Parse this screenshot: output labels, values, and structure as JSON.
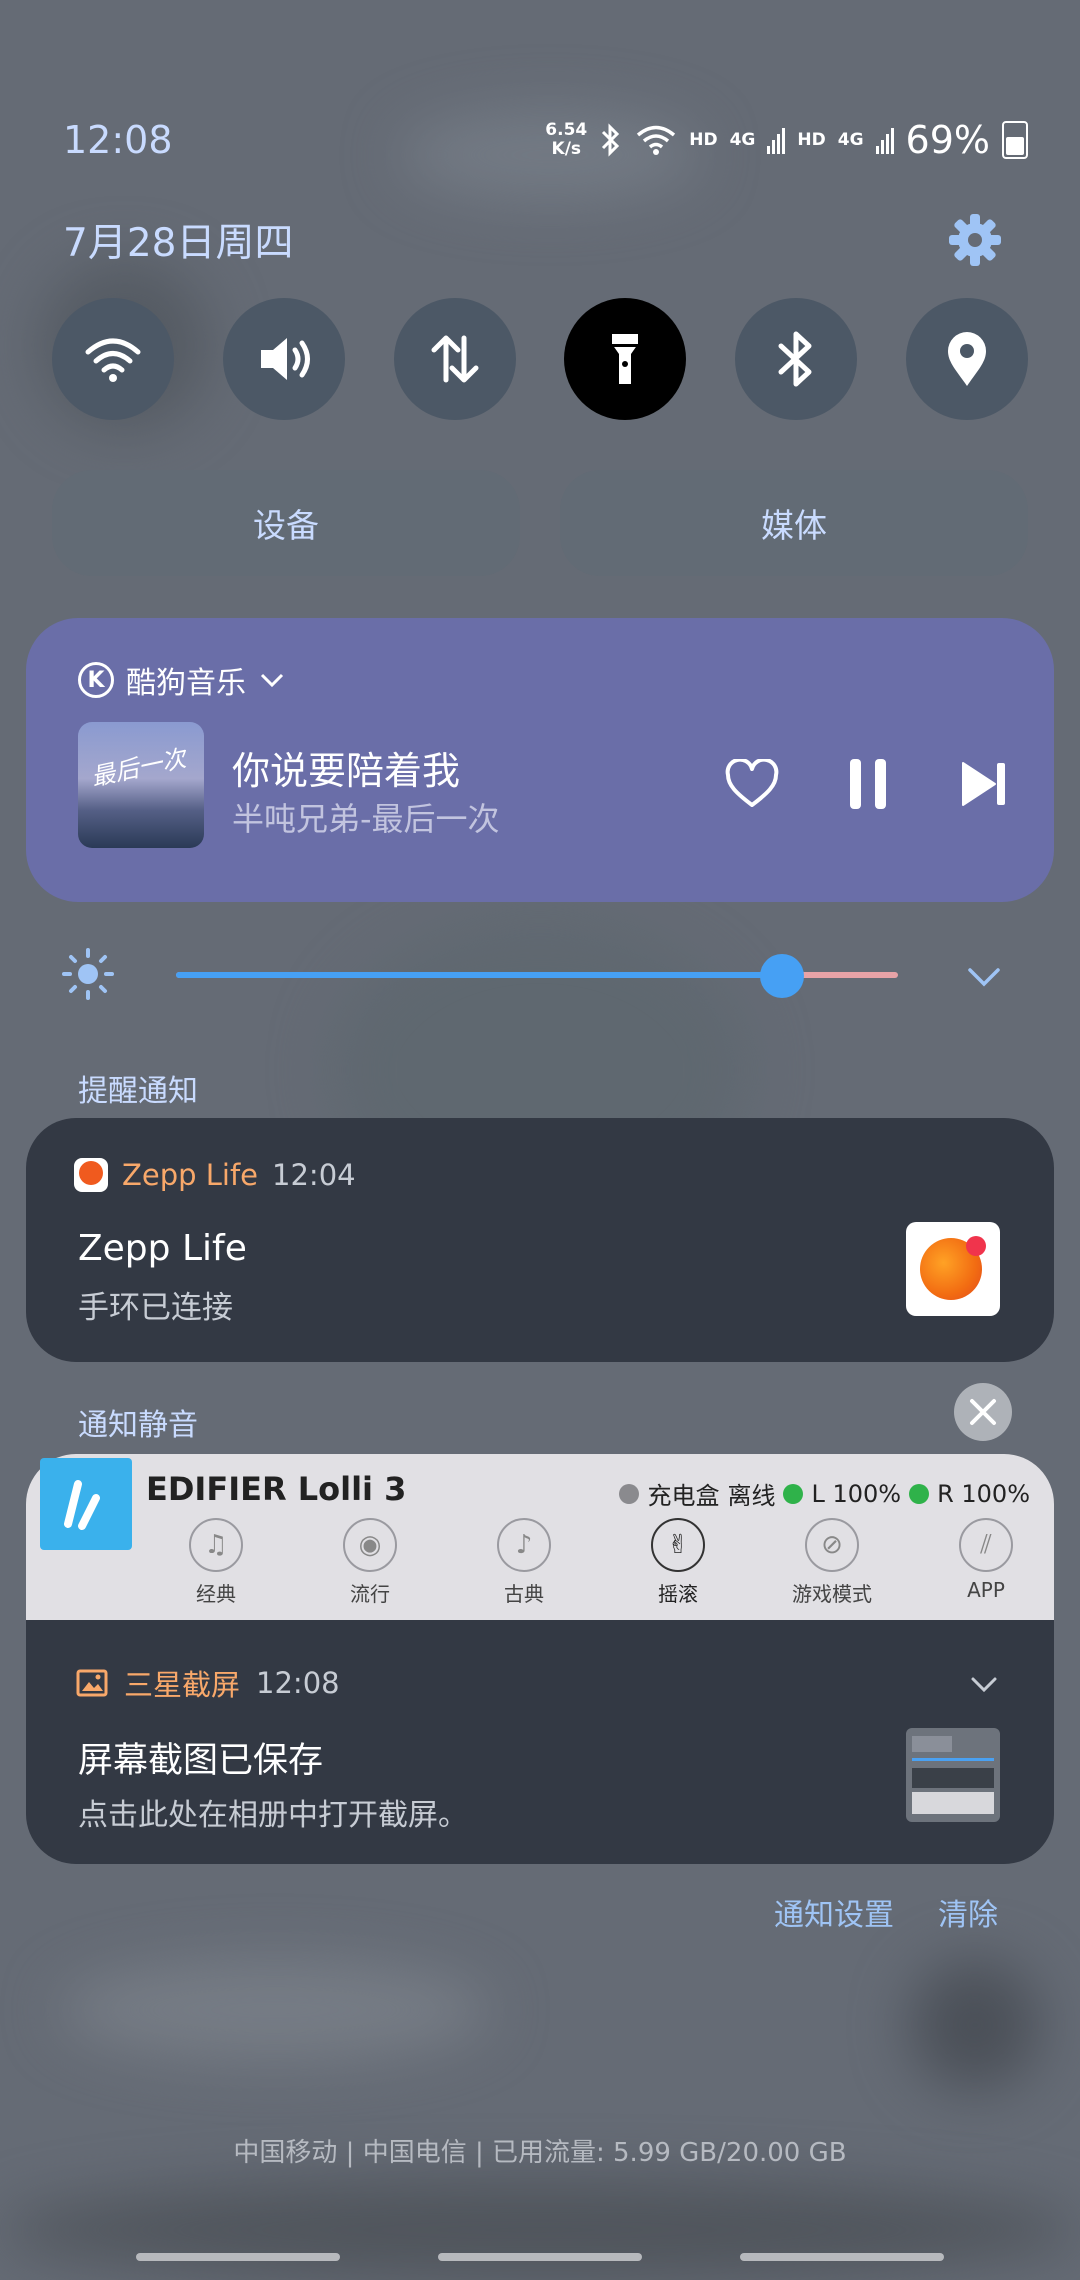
{
  "status_bar": {
    "time": "12:08",
    "net_speed_value": "6.54",
    "net_speed_unit": "K/s",
    "sim1_label": "HD",
    "sim1_net": "4G",
    "sim2_label": "HD",
    "sim2_net": "4G",
    "battery": "69%"
  },
  "header": {
    "date": "7月28日周四",
    "settings_icon": "gear-icon"
  },
  "quick_toggles": [
    {
      "icon": "wifi-icon",
      "active": false
    },
    {
      "icon": "volume-icon",
      "active": false
    },
    {
      "icon": "mobile-data-icon",
      "active": false
    },
    {
      "icon": "flashlight-icon",
      "active": true
    },
    {
      "icon": "bluetooth-icon",
      "active": false
    },
    {
      "icon": "location-icon",
      "active": false
    }
  ],
  "pills": {
    "devices": "设备",
    "media": "媒体"
  },
  "media": {
    "app": "酷狗音乐",
    "app_icon_letter": "K",
    "cover_text": "最后一次",
    "title": "你说要陪着我",
    "artist": "半吨兄弟-最后一次"
  },
  "brightness": {
    "level": 0.84
  },
  "sections": {
    "reminders": "提醒通知",
    "silent": "通知静音"
  },
  "zepp_notification": {
    "app": "Zepp Life",
    "time": "12:04",
    "title": "Zepp Life",
    "body": "手环已连接"
  },
  "edifier": {
    "title": "EDIFIER Lolli 3",
    "case_label": "充电盒",
    "case_status": "离线",
    "left": "L 100%",
    "right": "R 100%",
    "modes": [
      "经典",
      "流行",
      "古典",
      "摇滚",
      "游戏模式",
      "APP"
    ],
    "active_mode": "摇滚",
    "colors": {
      "case_dot": "#8a8a8e",
      "online_dot": "#2fb24a",
      "logo": "#3ab1ec"
    }
  },
  "screenshot_notification": {
    "app": "三星截屏",
    "time": "12:08",
    "title": "屏幕截图已保存",
    "body": "点击此处在相册中打开截屏。"
  },
  "actions": {
    "settings": "通知设置",
    "clear": "清除"
  },
  "carrier_info": "中国移动 | 中国电信 | 已用流量: 5.99 GB/20.00 GB"
}
